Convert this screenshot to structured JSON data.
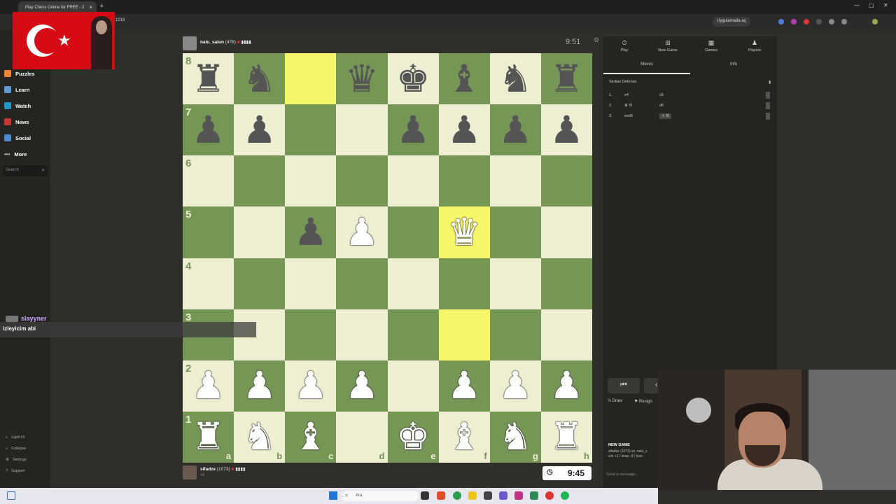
{
  "browser": {
    "tab_title": "Play Chess Online for FREE - 2",
    "url_suffix": "1218",
    "open_in_app": "Uygulamada aç"
  },
  "nav": {
    "items": [
      {
        "label": "Puzzles",
        "icon": "puzzle-icon"
      },
      {
        "label": "Learn",
        "icon": "learn-icon"
      },
      {
        "label": "Watch",
        "icon": "watch-icon"
      },
      {
        "label": "News",
        "icon": "news-icon"
      },
      {
        "label": "Social",
        "icon": "social-icon"
      },
      {
        "label": "More",
        "icon": "more-icon"
      }
    ],
    "search_placeholder": "Search",
    "bottom": [
      {
        "label": "Light UI"
      },
      {
        "label": "Collapse"
      },
      {
        "label": "Settings"
      },
      {
        "label": "Support"
      }
    ]
  },
  "chat": {
    "username": "slayyner",
    "message": "izleyicim abi"
  },
  "top_player": {
    "name": "nalu_salun",
    "rating": "(476)",
    "clock": "9:51"
  },
  "bottom_player": {
    "name": "sifadze",
    "rating": "(1073)",
    "clock": "9:45",
    "sub": "+1"
  },
  "board": {
    "ranks": [
      "8",
      "7",
      "6",
      "5",
      "4",
      "3",
      "2",
      "1"
    ],
    "files": [
      "a",
      "b",
      "c",
      "d",
      "e",
      "f",
      "g",
      "h"
    ],
    "highlight_squares": [
      "c8",
      "f5",
      "f3"
    ],
    "position": [
      [
        "br",
        "bn",
        "",
        "bq",
        "bk",
        "bb",
        "bn",
        "br"
      ],
      [
        "bp",
        "bp",
        "",
        "",
        "bp",
        "bp",
        "bp",
        "bp"
      ],
      [
        "",
        "",
        "",
        "",
        "",
        "",
        "",
        ""
      ],
      [
        "",
        "",
        "bp",
        "wp",
        "",
        "wq",
        "",
        ""
      ],
      [
        "",
        "",
        "",
        "",
        "",
        "",
        "",
        ""
      ],
      [
        "",
        "",
        "",
        "",
        "",
        "",
        "",
        ""
      ],
      [
        "wp",
        "wp",
        "wp",
        "wp",
        "",
        "wp",
        "wp",
        "wp"
      ],
      [
        "wr",
        "wn",
        "wb",
        "",
        "wk",
        "wb",
        "wn",
        "wr"
      ]
    ],
    "colors": {
      "light": "#eeeed2",
      "dark": "#769656",
      "highlight": "#f6f669"
    }
  },
  "right_panel": {
    "tabs": [
      {
        "label": "Play",
        "icon": "clock-icon"
      },
      {
        "label": "New Game",
        "icon": "plus-icon"
      },
      {
        "label": "Games",
        "icon": "grid-icon"
      },
      {
        "label": "Players",
        "icon": "players-icon"
      }
    ],
    "subtabs": [
      "Moves",
      "Info"
    ],
    "opening": "Sicilian Defense",
    "moves": [
      {
        "num": "1.",
        "white": "e4",
        "black": "c5"
      },
      {
        "num": "2.",
        "white": "♛ f3",
        "black": "d5"
      },
      {
        "num": "3.",
        "white": "exd5",
        "black": "♗ f5"
      }
    ],
    "draw_label": "Draw",
    "resign_label": "Resign",
    "new_game_title": "NEW GAME",
    "new_game_line1": "sifadze (1073) vs. nalu_s",
    "new_game_line2": "win +1 / draw -9 / lose -",
    "message_placeholder": "Send a message..."
  },
  "taskbar": {
    "search_placeholder": "Ara"
  }
}
